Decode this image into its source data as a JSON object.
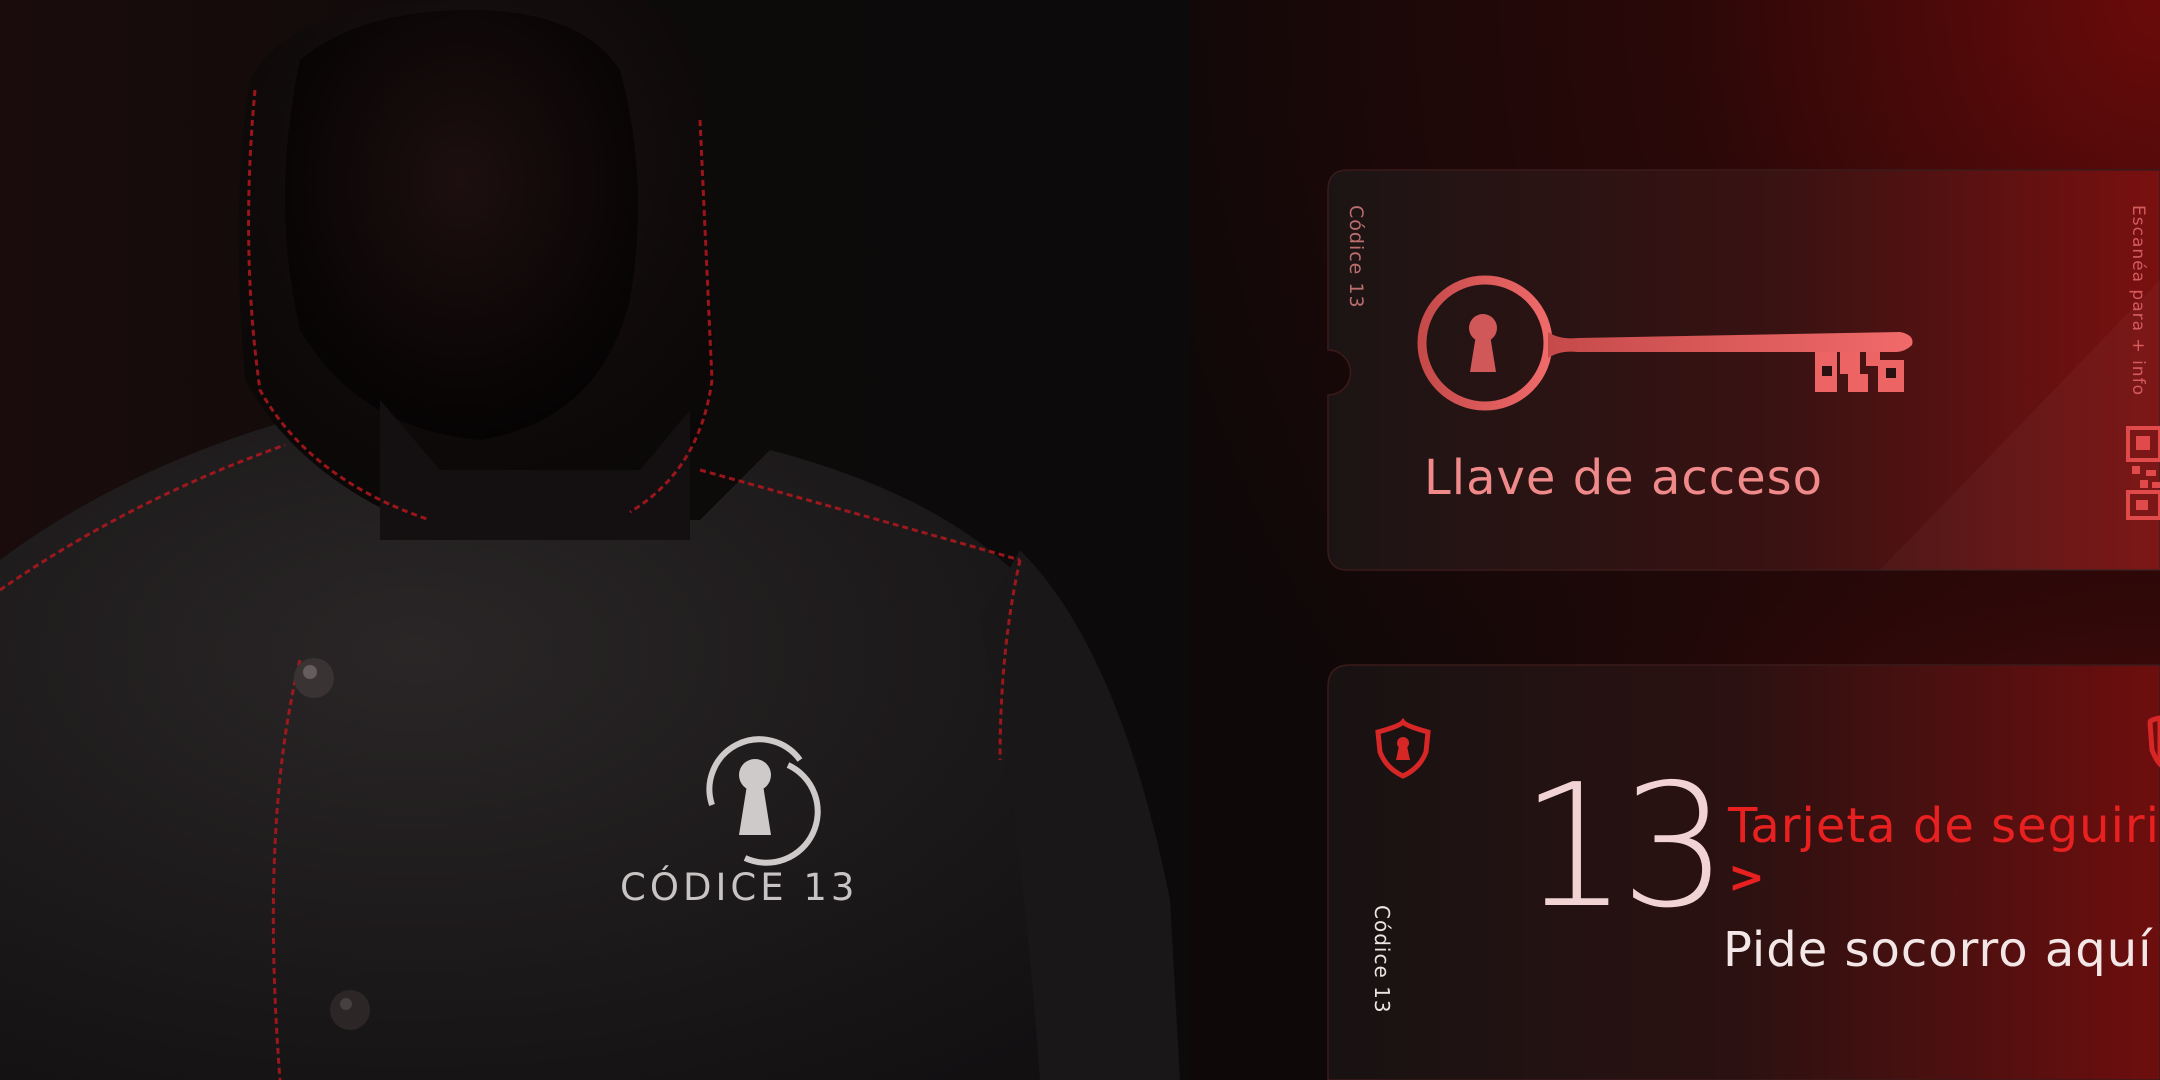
{
  "jacket": {
    "logo_text": "CÓDICE 13"
  },
  "access_card": {
    "brand": "Códice 13",
    "title": "Llave de acceso",
    "side_note": "Escanéa para + info"
  },
  "security_card": {
    "brand": "Códice 13",
    "number": "13",
    "title": "Tarjeta de seguiri",
    "arrow": ">",
    "subtitle": "Pide socorro aquí"
  },
  "colors": {
    "accent_red": "#e82020",
    "soft_red": "#f08a8a",
    "background": "#0a0606"
  },
  "icons": [
    "keyhole-logo-icon",
    "key-icon",
    "qr-code-icon",
    "shield-keyhole-icon"
  ]
}
